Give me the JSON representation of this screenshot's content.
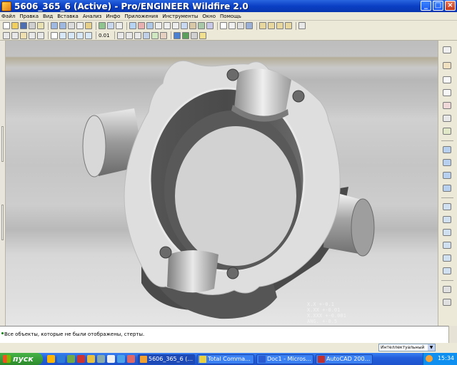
{
  "window": {
    "title": "5606_365_6 (Active) - Pro/ENGINEER Wildfire 2.0",
    "min": "_",
    "max": "□",
    "close": "×"
  },
  "menu": [
    "Файл",
    "Правка",
    "Вид",
    "Вставка",
    "Анализ",
    "Инфо",
    "Приложения",
    "Инструменты",
    "Окно",
    "Помощь"
  ],
  "toolbar": {
    "scale_label": "0.01"
  },
  "viewport": {
    "annotations": [
      "X.X  +-0.1",
      "X.XX  +-0.01",
      "X.XXX  +-0.001",
      "ANG.  +-0.5"
    ]
  },
  "message": "Все объекты, которые не были отображены, стерты.",
  "filter": {
    "value": "Интеллектуальный"
  },
  "taskbar": {
    "start": "пуск",
    "tasks": [
      "5606_365_6 (...",
      "Total Comma...",
      "Doc1 - Micros...",
      "AutoCAD 200..."
    ],
    "clock": "15:34"
  }
}
